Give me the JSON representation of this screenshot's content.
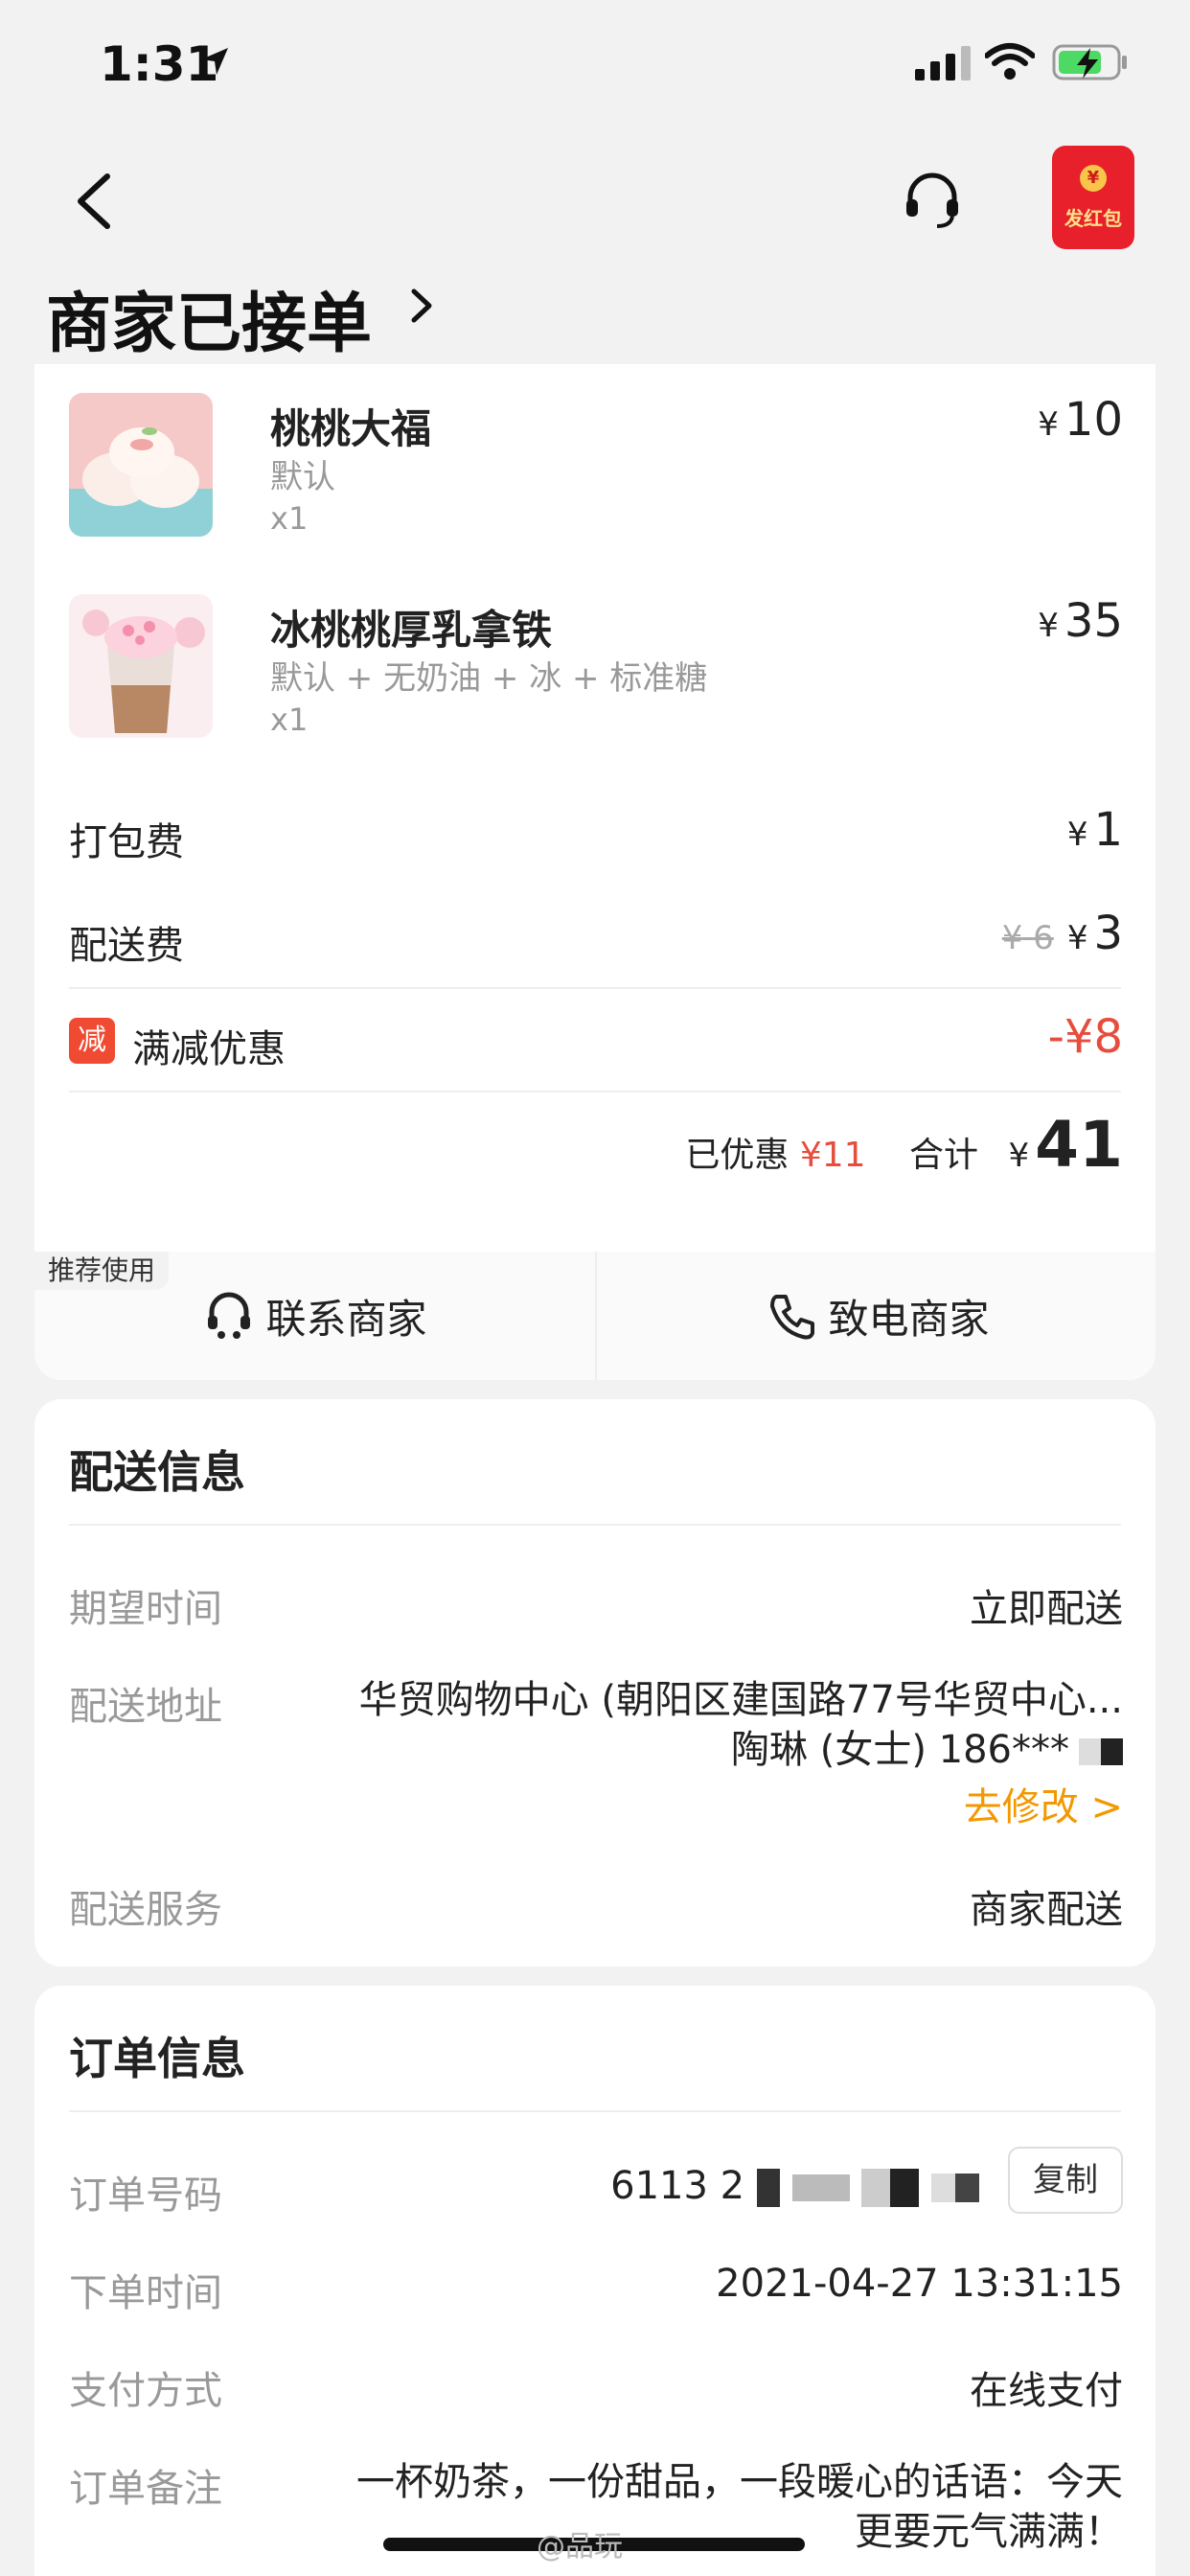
{
  "status_bar": {
    "time": "1:31"
  },
  "header": {
    "title": "商家已接单",
    "redpacket_label": "发红包",
    "coin_symbol": "¥"
  },
  "items": [
    {
      "name": "桃桃大福",
      "spec": "默认",
      "qty": "x1",
      "price": "10"
    },
    {
      "name": "冰桃桃厚乳拿铁",
      "spec": "默认 + 无奶油 + 冰 + 标准糖",
      "qty": "x1",
      "price": "35"
    }
  ],
  "currency": "¥",
  "fees": {
    "packing_label": "打包费",
    "packing_value": "1",
    "delivery_label": "配送费",
    "delivery_original": "6",
    "delivery_value": "3",
    "discount_badge": "减",
    "discount_label": "满减优惠",
    "discount_value": "-¥8"
  },
  "totals": {
    "saved_label": "已优惠",
    "saved_value": "¥11",
    "total_label": "合计",
    "total_value": "41"
  },
  "actions": {
    "recommend_tag": "推荐使用",
    "contact_label": "联系商家",
    "call_label": "致电商家"
  },
  "delivery": {
    "title": "配送信息",
    "expected_label": "期望时间",
    "expected_value": "立即配送",
    "address_label": "配送地址",
    "address_line1": "华贸购物中心 (朝阳区建国路77号华贸中心...",
    "address_line2": "陶琳 (女士) 186***",
    "modify_label": "去修改 >",
    "service_label": "配送服务",
    "service_value": "商家配送"
  },
  "order": {
    "title": "订单信息",
    "number_label": "订单号码",
    "number_value": "6113 2",
    "copy_label": "复制",
    "time_label": "下单时间",
    "time_value": "2021-04-27 13:31:15",
    "pay_label": "支付方式",
    "pay_value": "在线支付",
    "note_label": "订单备注",
    "note_line1": "一杯奶茶，一份甜品，一段暖心的话语：今天",
    "note_line2": "更要元气满满！"
  },
  "watermark": "@品玩"
}
